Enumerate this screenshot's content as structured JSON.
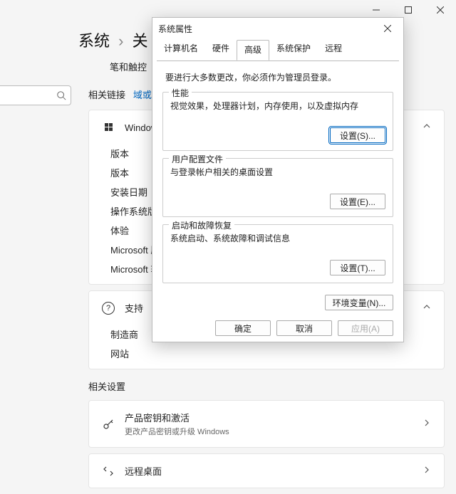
{
  "window": {
    "min": "—",
    "max": "□",
    "close": "×"
  },
  "breadcrumb": {
    "a": "系统",
    "sep": "›",
    "b": "关"
  },
  "sidebar": {
    "pen": "笔和触控",
    "related_links": "相关链接",
    "domain_link": "域或工"
  },
  "specs": {
    "header": "Windows 规",
    "rows": [
      "版本",
      "版本",
      "安装日期",
      "操作系统版本",
      "体验"
    ],
    "links": [
      "Microsoft 服",
      "Microsoft 软"
    ]
  },
  "support": {
    "title": "支持",
    "rows": [
      "制造商",
      "网站"
    ]
  },
  "related": {
    "heading": "相关设置",
    "activation": {
      "title": "产品密钥和激活",
      "sub": "更改产品密钥或升级 Windows"
    },
    "remote": {
      "title": "远程桌面"
    }
  },
  "dialog": {
    "title": "系统属性",
    "tabs": [
      "计算机名",
      "硬件",
      "高级",
      "系统保护",
      "远程"
    ],
    "active_tab": 2,
    "note": "要进行大多数更改，你必须作为管理员登录。",
    "groups": {
      "perf": {
        "legend": "性能",
        "desc": "视觉效果，处理器计划，内存使用，以及虚拟内存",
        "btn": "设置(S)..."
      },
      "profile": {
        "legend": "用户配置文件",
        "desc": "与登录帐户相关的桌面设置",
        "btn": "设置(E)..."
      },
      "startup": {
        "legend": "启动和故障恢复",
        "desc": "系统启动、系统故障和调试信息",
        "btn": "设置(T)..."
      }
    },
    "env_btn": "环境变量(N)...",
    "footer": {
      "ok": "确定",
      "cancel": "取消",
      "apply": "应用(A)"
    }
  }
}
